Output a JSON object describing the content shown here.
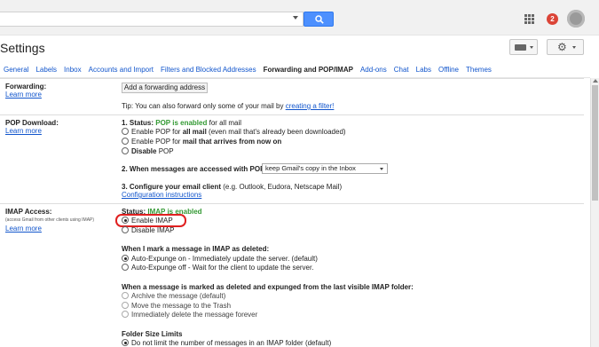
{
  "page_title": "Settings",
  "notifications": {
    "count": "2"
  },
  "tabs": [
    "General",
    "Labels",
    "Inbox",
    "Accounts and Import",
    "Filters and Blocked Addresses",
    "Forwarding and POP/IMAP",
    "Add-ons",
    "Chat",
    "Labs",
    "Offline",
    "Themes"
  ],
  "active_tab": "Forwarding and POP/IMAP",
  "forwarding": {
    "label": "Forwarding:",
    "learn_more": "Learn more",
    "button": "Add a forwarding address",
    "tip": "Tip: You can also forward only some of your mail by",
    "tip_link": "creating a filter!"
  },
  "pop": {
    "label": "POP Download:",
    "learn_more": "Learn more",
    "status_prefix": "1. Status:",
    "status_value": "POP is enabled",
    "status_suffix": "for all mail",
    "options": [
      {
        "pre": "Enable POP for",
        "bold": "all mail",
        "post": "(even mail that's already been downloaded)",
        "selected": false
      },
      {
        "pre": "Enable POP for",
        "bold": "mail that arrives from now on",
        "post": "",
        "selected": false
      },
      {
        "pre": "",
        "bold": "Disable",
        "post": "POP",
        "selected": false
      }
    ],
    "access_label": "2. When messages are accessed with POP",
    "access_select": "keep Gmail's copy in the Inbox",
    "configure_label": "3. Configure your email client",
    "configure_hint": "(e.g. Outlook, Eudora, Netscape Mail)",
    "configure_link": "Configuration instructions"
  },
  "imap": {
    "label": "IMAP Access:",
    "sublabel": "(access Gmail from other clients using IMAP)",
    "learn_more": "Learn more",
    "status_prefix": "Status:",
    "status_value": "IMAP is enabled",
    "enable": "Enable IMAP",
    "disable": "Disable IMAP",
    "enabled": true,
    "deleted_heading": "When I mark a message in IMAP as deleted:",
    "deleted_options": [
      {
        "text": "Auto-Expunge on - Immediately update the server. (default)",
        "selected": true
      },
      {
        "text": "Auto-Expunge off - Wait for the client to update the server.",
        "selected": false
      }
    ],
    "expunged_heading": "When a message is marked as deleted and expunged from the last visible IMAP folder:",
    "expunged_options": [
      {
        "text": "Archive the message (default)",
        "selected": false
      },
      {
        "text": "Move the message to the Trash",
        "selected": false
      },
      {
        "text": "Immediately delete the message forever",
        "selected": false
      }
    ],
    "folder_heading": "Folder Size Limits",
    "folder_options": [
      {
        "text": "Do not limit the number of messages in an IMAP folder (default)",
        "selected": true
      }
    ]
  }
}
